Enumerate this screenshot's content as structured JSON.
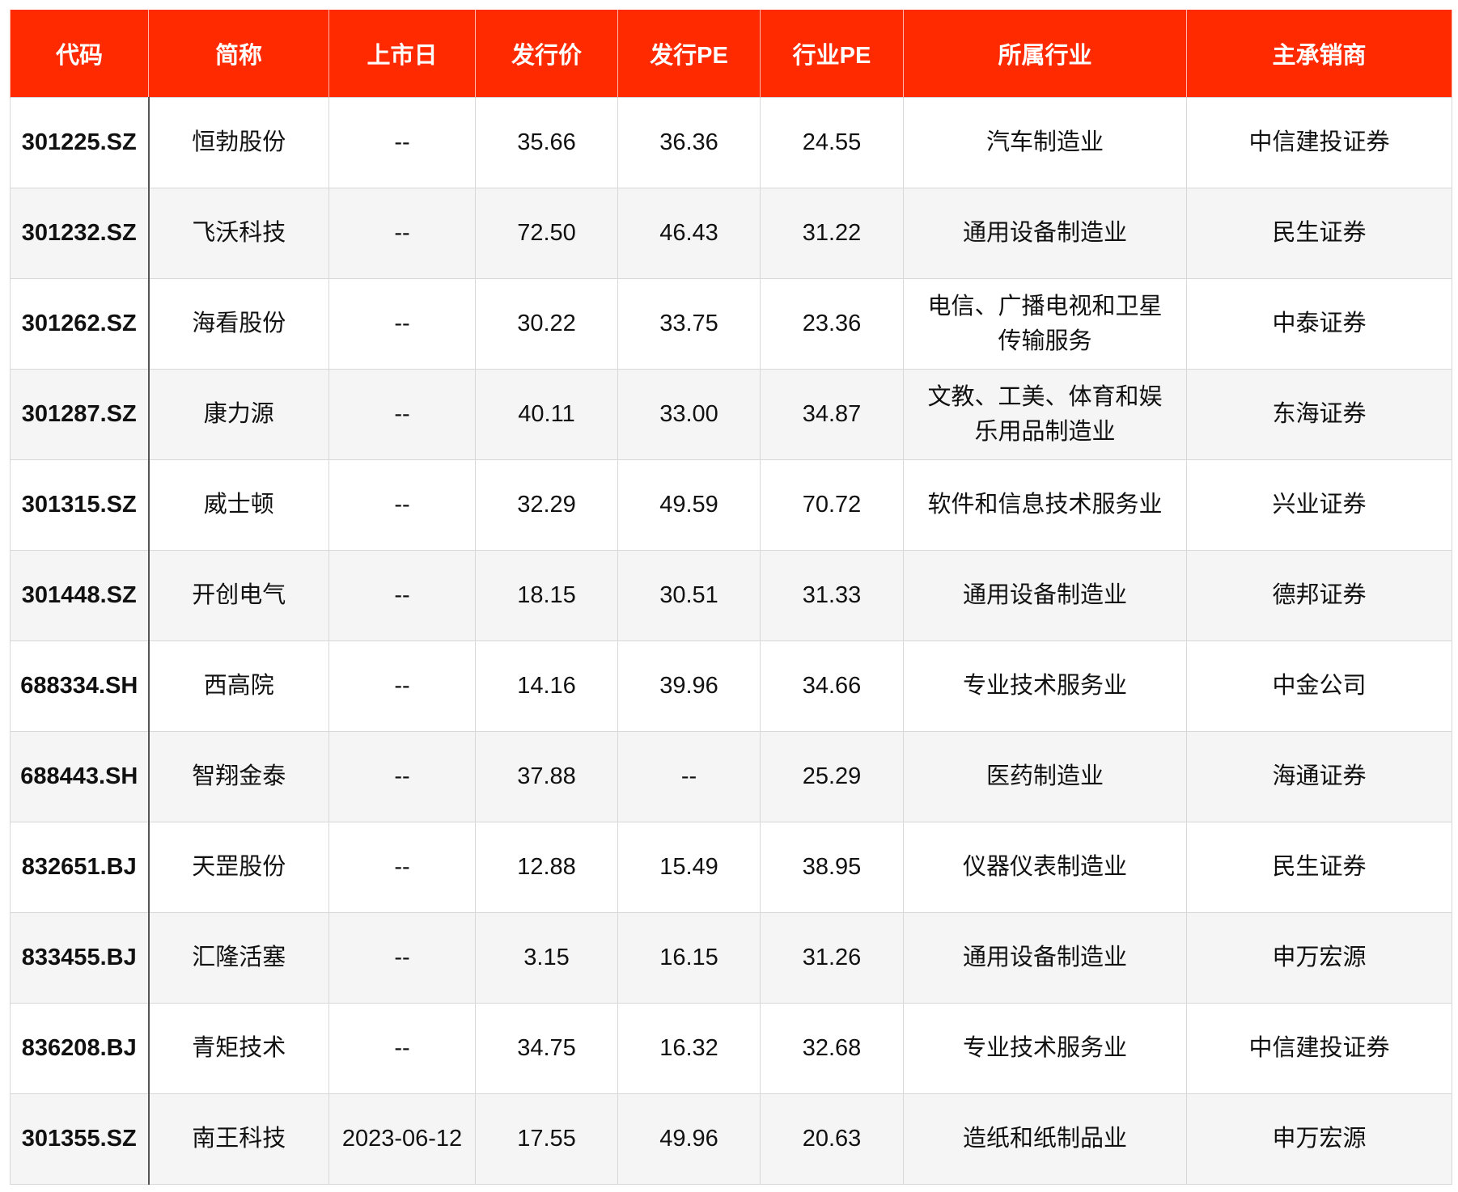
{
  "headers": [
    "代码",
    "简称",
    "上市日",
    "发行价",
    "发行PE",
    "行业PE",
    "所属行业",
    "主承销商"
  ],
  "rows": [
    {
      "code": "301225.SZ",
      "name": "恒勃股份",
      "list_date": "--",
      "issue_price": "35.66",
      "issue_pe": "36.36",
      "industry_pe": "24.55",
      "industry": "汽车制造业",
      "underwriter": "中信建投证券"
    },
    {
      "code": "301232.SZ",
      "name": "飞沃科技",
      "list_date": "--",
      "issue_price": "72.50",
      "issue_pe": "46.43",
      "industry_pe": "31.22",
      "industry": "通用设备制造业",
      "underwriter": "民生证券"
    },
    {
      "code": "301262.SZ",
      "name": "海看股份",
      "list_date": "--",
      "issue_price": "30.22",
      "issue_pe": "33.75",
      "industry_pe": "23.36",
      "industry": "电信、广播电视和卫星传输服务",
      "underwriter": "中泰证券"
    },
    {
      "code": "301287.SZ",
      "name": "康力源",
      "list_date": "--",
      "issue_price": "40.11",
      "issue_pe": "33.00",
      "industry_pe": "34.87",
      "industry": "文教、工美、体育和娱乐用品制造业",
      "underwriter": "东海证券"
    },
    {
      "code": "301315.SZ",
      "name": "威士顿",
      "list_date": "--",
      "issue_price": "32.29",
      "issue_pe": "49.59",
      "industry_pe": "70.72",
      "industry": "软件和信息技术服务业",
      "underwriter": "兴业证券"
    },
    {
      "code": "301448.SZ",
      "name": "开创电气",
      "list_date": "--",
      "issue_price": "18.15",
      "issue_pe": "30.51",
      "industry_pe": "31.33",
      "industry": "通用设备制造业",
      "underwriter": "德邦证券"
    },
    {
      "code": "688334.SH",
      "name": "西高院",
      "list_date": "--",
      "issue_price": "14.16",
      "issue_pe": "39.96",
      "industry_pe": "34.66",
      "industry": "专业技术服务业",
      "underwriter": "中金公司"
    },
    {
      "code": "688443.SH",
      "name": "智翔金泰",
      "list_date": "--",
      "issue_price": "37.88",
      "issue_pe": "--",
      "industry_pe": "25.29",
      "industry": "医药制造业",
      "underwriter": "海通证券"
    },
    {
      "code": "832651.BJ",
      "name": "天罡股份",
      "list_date": "--",
      "issue_price": "12.88",
      "issue_pe": "15.49",
      "industry_pe": "38.95",
      "industry": "仪器仪表制造业",
      "underwriter": "民生证券"
    },
    {
      "code": "833455.BJ",
      "name": "汇隆活塞",
      "list_date": "--",
      "issue_price": "3.15",
      "issue_pe": "16.15",
      "industry_pe": "31.26",
      "industry": "通用设备制造业",
      "underwriter": "申万宏源"
    },
    {
      "code": "836208.BJ",
      "name": "青矩技术",
      "list_date": "--",
      "issue_price": "34.75",
      "issue_pe": "16.32",
      "industry_pe": "32.68",
      "industry": "专业技术服务业",
      "underwriter": "中信建投证券"
    },
    {
      "code": "301355.SZ",
      "name": "南王科技",
      "list_date": "2023-06-12",
      "issue_price": "17.55",
      "issue_pe": "49.96",
      "industry_pe": "20.63",
      "industry": "造纸和纸制品业",
      "underwriter": "申万宏源"
    }
  ]
}
